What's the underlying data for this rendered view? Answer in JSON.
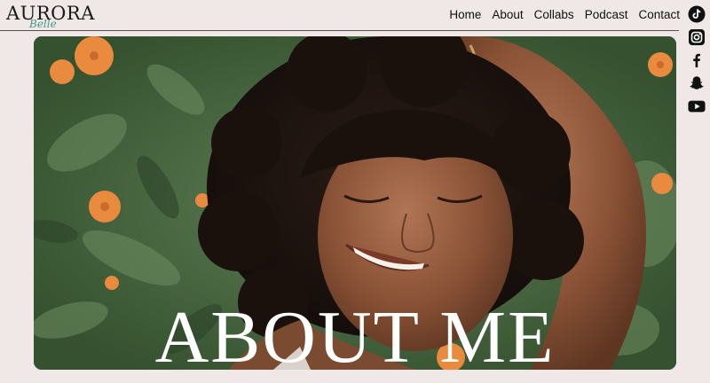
{
  "brand": {
    "name": "AURORA",
    "script": "Belle"
  },
  "nav": {
    "items": [
      "Home",
      "About",
      "Collabs",
      "Podcast",
      "Contact"
    ]
  },
  "social": {
    "icons": [
      "tiktok-icon",
      "instagram-icon",
      "facebook-icon",
      "snapchat-icon",
      "youtube-icon"
    ]
  },
  "hero": {
    "title": "ABOUT ME"
  },
  "colors": {
    "background": "#efe8e6",
    "accent": "#3f9a8a",
    "text": "#111111",
    "title": "#ffffff"
  }
}
